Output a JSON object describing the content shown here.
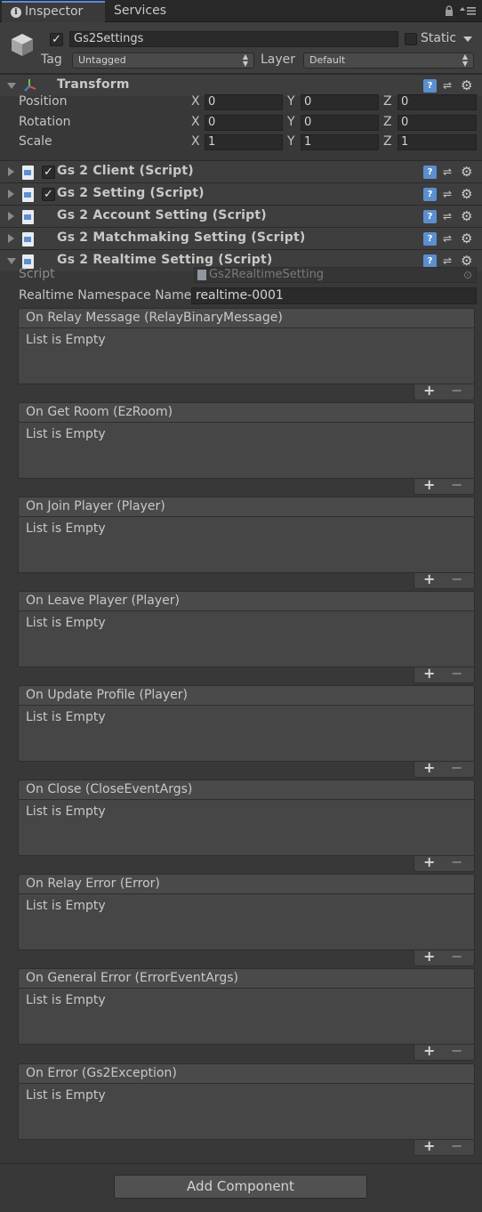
{
  "tabs": [
    {
      "label": "Inspector",
      "active": true
    },
    {
      "label": "Services",
      "active": false
    }
  ],
  "gameobject": {
    "active": true,
    "name": "Gs2Settings",
    "static_label": "Static",
    "static_checked": false,
    "tag_label": "Tag",
    "tag_value": "Untagged",
    "layer_label": "Layer",
    "layer_value": "Default"
  },
  "transform": {
    "title": "Transform",
    "rows": [
      {
        "label": "Position",
        "x": "0",
        "y": "0",
        "z": "0"
      },
      {
        "label": "Rotation",
        "x": "0",
        "y": "0",
        "z": "0"
      },
      {
        "label": "Scale",
        "x": "1",
        "y": "1",
        "z": "1"
      }
    ],
    "axis": {
      "x": "X",
      "y": "Y",
      "z": "Z"
    }
  },
  "components": [
    {
      "title": "Gs 2 Client (Script)",
      "has_checkbox": true,
      "checked": true,
      "expanded": false
    },
    {
      "title": "Gs 2 Setting (Script)",
      "has_checkbox": true,
      "checked": true,
      "expanded": false
    },
    {
      "title": "Gs 2 Account Setting (Script)",
      "has_checkbox": false,
      "expanded": false
    },
    {
      "title": "Gs 2 Matchmaking Setting (Script)",
      "has_checkbox": false,
      "expanded": false
    },
    {
      "title": "Gs 2 Realtime Setting (Script)",
      "has_checkbox": false,
      "expanded": true
    }
  ],
  "realtime": {
    "script_label": "Script",
    "script_value": "Gs2RealtimeSetting",
    "namespace_label": "Realtime Namespace Name",
    "namespace_value": "realtime-0001",
    "events": [
      {
        "header": "On Relay Message (RelayBinaryMessage)",
        "body": "List is Empty"
      },
      {
        "header": "On Get Room (EzRoom)",
        "body": "List is Empty"
      },
      {
        "header": "On Join Player (Player)",
        "body": "List is Empty"
      },
      {
        "header": "On Leave Player (Player)",
        "body": "List is Empty"
      },
      {
        "header": "On Update Profile (Player)",
        "body": "List is Empty"
      },
      {
        "header": "On Close (CloseEventArgs)",
        "body": "List is Empty"
      },
      {
        "header": "On Relay Error (Error)",
        "body": "List is Empty"
      },
      {
        "header": "On General Error (ErrorEventArgs)",
        "body": "List is Empty"
      },
      {
        "header": "On Error (Gs2Exception)",
        "body": "List is Empty"
      }
    ],
    "plus": "+",
    "minus": "−"
  },
  "add_component_label": "Add Component",
  "icons": {
    "info": "info-icon",
    "lock": "lock-icon",
    "menu": "menu-icon",
    "cube": "gameobject-cube-icon",
    "help": "help-icon",
    "preset": "preset-icon",
    "gear": "gear-icon"
  },
  "colors": {
    "background": "#383838",
    "tab_accent": "#5b8bd6",
    "help_blue": "#5b8fcf"
  }
}
